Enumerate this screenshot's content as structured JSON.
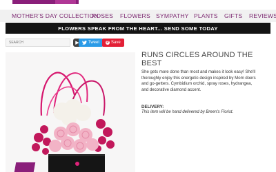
{
  "nav": {
    "items": [
      "MOTHER'S DAY COLLECTION",
      "ROSES",
      "FLOWERS",
      "SYMPATHY",
      "PLANTS",
      "GIFTS",
      "REVIEWS"
    ]
  },
  "banner": {
    "text": "FLOWERS SPEAK FROM THE HEART... SEND SOME TODAY"
  },
  "search": {
    "placeholder": "SEARCH",
    "button_icon": "arrow-right-icon"
  },
  "share": {
    "tweet_label": "Tweet",
    "save_label": "Save"
  },
  "product": {
    "title": "RUNS CIRCLES AROUND THE BEST",
    "description": "She gets more done than most and makes it look easy! She'll thoroughly enjoy this energetic design inspired by Mom doers and go-getters. Cymbidium orchid, spray roses, hydrangea, and decorative diamond accent.",
    "delivery_label": "DELIVERY:",
    "delivery_text": "This item will be hand delivered by Breen's Florist."
  },
  "colors": {
    "brand": "#8a1f7a",
    "banner_bg": "#141414",
    "twitter": "#2b9be7",
    "pinterest": "#e32036"
  }
}
